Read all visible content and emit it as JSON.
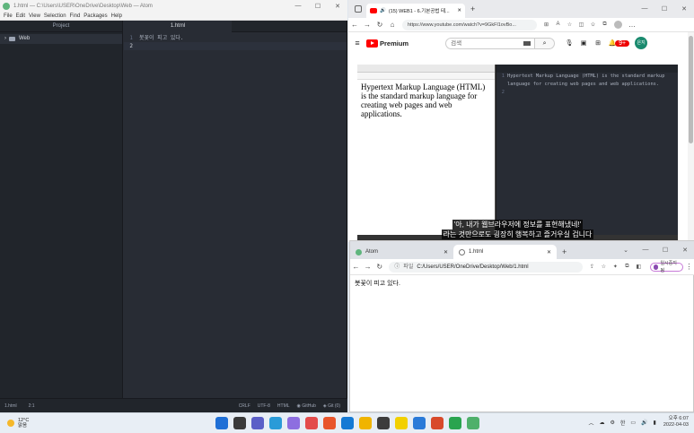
{
  "atom": {
    "title": "1.html — C:\\Users\\USER\\OneDrive\\Desktop\\Web — Atom",
    "menu": [
      "File",
      "Edit",
      "View",
      "Selection",
      "Find",
      "Packages",
      "Help"
    ],
    "tree_header": "Project",
    "tree_items": [
      {
        "label": "Web"
      }
    ],
    "tab_label": "1.html",
    "lines": [
      {
        "num": "1",
        "text": "봇꽃이 피고 있다."
      },
      {
        "num": "2",
        "text": ""
      }
    ],
    "status": {
      "file": "1.html",
      "cursor": "2:1",
      "line_ending": "CRLF",
      "encoding": "UTF-8",
      "grammar": "HTML",
      "github": "GitHub",
      "git": "Git (0)"
    }
  },
  "edge": {
    "tab_title": "(15) WEB1 - 6.기본공법 테...",
    "url": "https://www.youtube.com/watch?v=9GkFl1ovBo...",
    "youtube": {
      "logo_text": "Premium",
      "search_placeholder": "검색",
      "notif_count": "9+",
      "avatar_label": "은지"
    },
    "video": {
      "page_text": "Hypertext Markup Language (HTML) is the standard markup language for creating web pages and web applications.",
      "code_lines": [
        {
          "num": "1",
          "text": "Hypertext Markup Language (HTML) is the standard markup"
        },
        {
          "num": "",
          "text": "language for creating web pages and web applications."
        },
        {
          "num": "2",
          "text": ""
        }
      ],
      "subtitles": [
        "'아, 내가 웹브라우저에 정보를 표현해냈네!'",
        "라는 것만으로도 굉장히 행복하고 즐거우실 겁니다"
      ]
    }
  },
  "chrome": {
    "tabs": [
      {
        "label": "Atom",
        "active": false
      },
      {
        "label": "1.html",
        "active": true
      }
    ],
    "url_label": "파일",
    "url": "C:/Users/USER/OneDrive/Desktop/Web/1.html",
    "profile_label": "일시중지됨",
    "content": "봇꽃이 피고 있다."
  },
  "taskbar": {
    "weather_temp": "12°C",
    "weather_desc": "맑음",
    "lang": "한",
    "time": "오후 6:07",
    "date": "2022-04-03",
    "app_colors": [
      "#1f6fd6",
      "#3a3a3a",
      "#5b5fc7",
      "#2a9bd8",
      "#8d6ee0",
      "#e34b4b",
      "#e8552b",
      "#1479d4",
      "#f0b400",
      "#3c3c3c",
      "#f2d000",
      "#2a7ad8",
      "#d84a2b",
      "#2aa44f",
      "#4fb06b"
    ]
  }
}
